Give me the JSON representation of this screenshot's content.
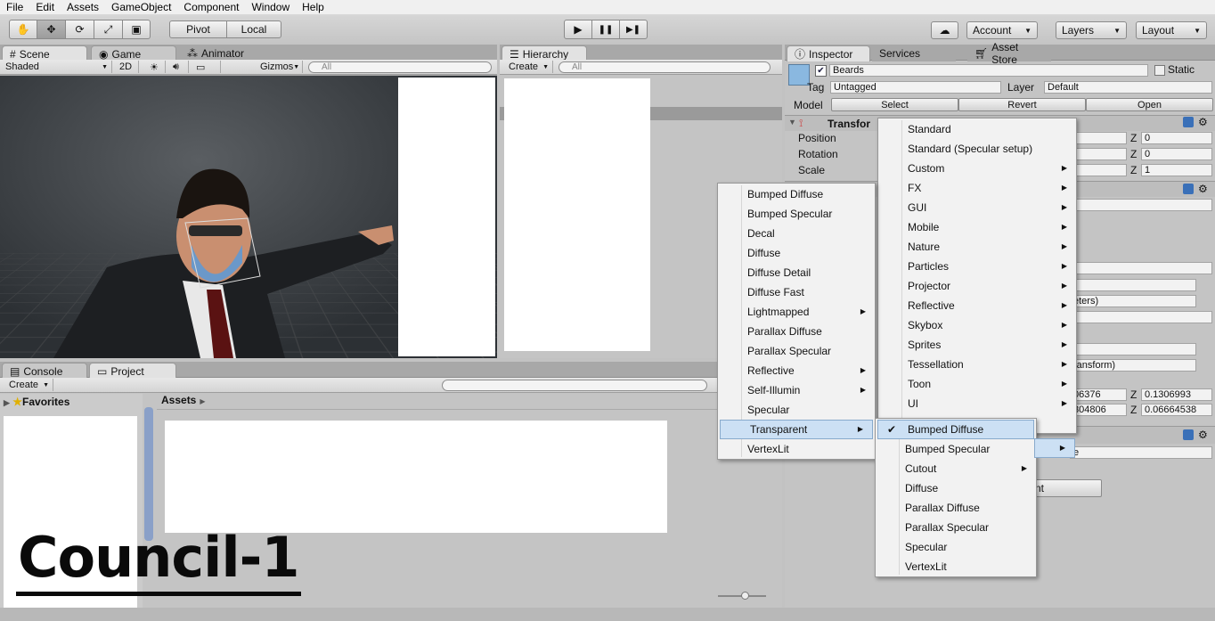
{
  "menubar": [
    "File",
    "Edit",
    "Assets",
    "GameObject",
    "Component",
    "Window",
    "Help"
  ],
  "toolbar": {
    "tools": [
      "hand-icon",
      "move-icon",
      "rotate-icon",
      "scale-icon",
      "rect-icon"
    ],
    "pivot": "Pivot",
    "local": "Local",
    "play": "▶",
    "pause": "❚❚",
    "step": "▶❚",
    "account": "Account",
    "layers": "Layers",
    "layout": "Layout"
  },
  "scene_panel": {
    "tabs": [
      "Scene",
      "Game",
      "Animator"
    ],
    "shaded": "Shaded",
    "mode2d": "2D",
    "gizmos": "Gizmos",
    "search_placeholder": "All"
  },
  "hierarchy": {
    "tab": "Hierarchy",
    "create": "Create",
    "search_placeholder": "All"
  },
  "inspector": {
    "tabs": [
      "Inspector",
      "Services",
      "Asset Store"
    ],
    "object_name": "Beards",
    "static_label": "Static",
    "tag_label": "Tag",
    "tag_value": "Untagged",
    "layer_label": "Layer",
    "layer_value": "Default",
    "model_label": "Model",
    "select": "Select",
    "revert": "Revert",
    "open": "Open",
    "transform": "Transfor",
    "position": "Position",
    "rotation": "Rotation",
    "scale": "Scale",
    "z_label": "Z",
    "pos_z": "0",
    "rot_z": "0",
    "scale_z": "1",
    "partial_meters": "eters)",
    "partial_transform": "ransform)",
    "partial_v1": "06376",
    "partial_v2": "304806",
    "z_v1": "0.1306993",
    "z_v2": "0.06664538",
    "partial_e": "e",
    "partial_nt": "nt"
  },
  "bottom": {
    "tabs": [
      "Console",
      "Project"
    ],
    "create": "Create",
    "favorites": "Favorites",
    "assets": "Assets"
  },
  "watermark": "Council-1",
  "menu_main": [
    "Standard",
    "Standard (Specular setup)",
    "Custom",
    "FX",
    "GUI",
    "Mobile",
    "Nature",
    "Particles",
    "Projector",
    "Reflective",
    "Skybox",
    "Sprites",
    "Tessellation",
    "Toon",
    "UI"
  ],
  "menu_main_sub": [
    false,
    false,
    true,
    true,
    true,
    true,
    true,
    true,
    true,
    true,
    true,
    true,
    true,
    true,
    true
  ],
  "menu_legacy": [
    "Bumped Diffuse",
    "Bumped Specular",
    "Decal",
    "Diffuse",
    "Diffuse Detail",
    "Diffuse Fast",
    "Lightmapped",
    "Parallax Diffuse",
    "Parallax Specular",
    "Reflective",
    "Self-Illumin",
    "Specular",
    "Transparent",
    "VertexLit"
  ],
  "menu_legacy_sub": [
    false,
    false,
    false,
    false,
    false,
    false,
    true,
    false,
    false,
    true,
    true,
    false,
    true,
    false
  ],
  "menu_transparent": [
    "Bumped Diffuse",
    "Bumped Specular",
    "Cutout",
    "Diffuse",
    "Parallax Diffuse",
    "Parallax Specular",
    "Specular",
    "VertexLit"
  ],
  "menu_transparent_sub": [
    false,
    false,
    true,
    false,
    false,
    false,
    false,
    false
  ],
  "checked_item": "Bumped Diffuse"
}
